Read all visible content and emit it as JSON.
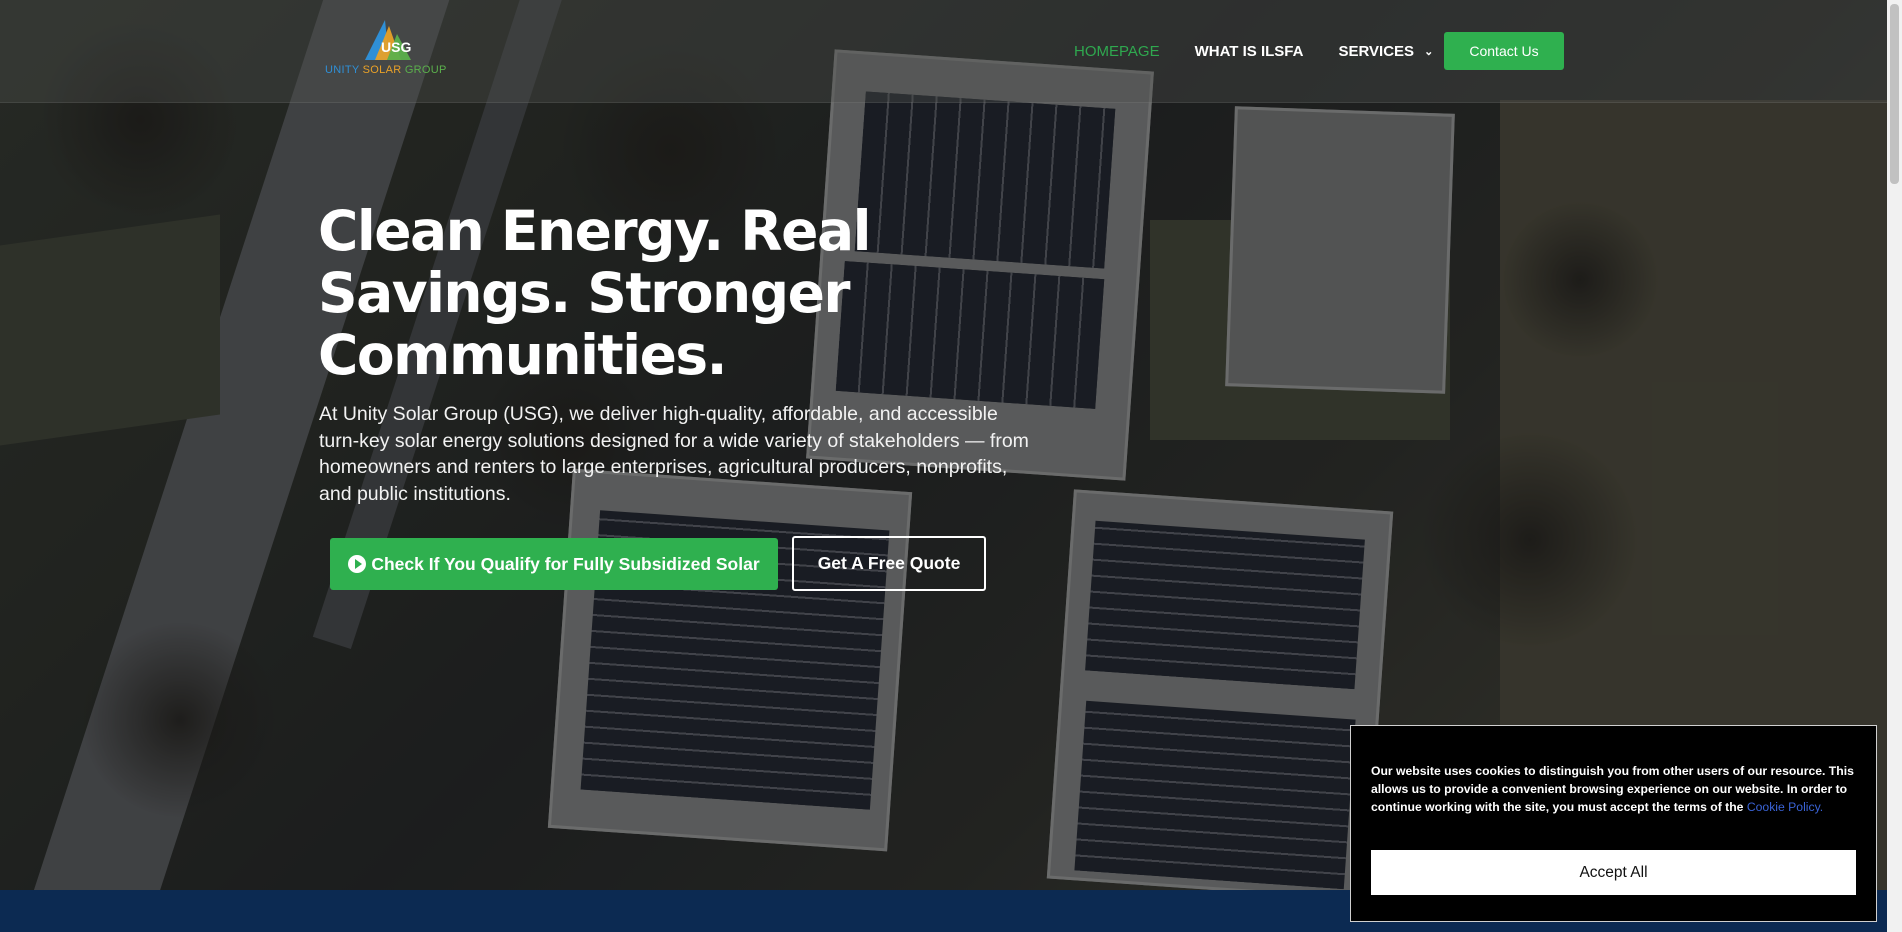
{
  "brand": {
    "logo_text_part1": "UNITY ",
    "logo_text_part2": "SOLAR ",
    "logo_text_part3": "GROUP",
    "colors": {
      "blue": "#2f8fd6",
      "orange": "#e8a128",
      "green": "#5bb04c"
    }
  },
  "nav": {
    "items": [
      {
        "label": "HOMEPAGE",
        "active": true
      },
      {
        "label": "WHAT IS ILSFA",
        "active": false
      },
      {
        "label": "SERVICES",
        "active": false,
        "icon": "chevron-down-icon"
      }
    ],
    "contact_label": "Contact Us"
  },
  "hero": {
    "headline": "Clean Energy. Real Savings. Stronger Communities.",
    "intro": "At Unity Solar Group (USG), we deliver high-quality, affordable, and accessible turn-key solar energy solutions designed for a wide variety of stakeholders — from homeowners and renters to large enterprises, agricultural producers, nonprofits, and public institutions.",
    "primary_cta": {
      "label": "Check If You Qualify for Fully Subsidized Solar",
      "icon": "play-circle-icon"
    },
    "secondary_cta": {
      "label": "Get A Free Quote"
    }
  },
  "cookie": {
    "text": "Our website uses cookies to distinguish you from other users of our resource. This allows us to provide a convenient browsing experience on our website. In order to continue working with the site, you must accept the terms of the ",
    "link_label": "Cookie Policy.",
    "accept_label": "Accept All"
  },
  "theme": {
    "accent": "#2fb04f",
    "band": "#0c2a52",
    "link": "#3a63d6"
  }
}
